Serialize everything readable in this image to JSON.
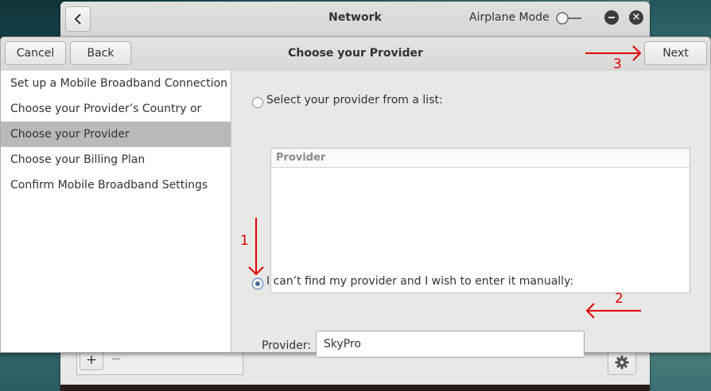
{
  "network_window": {
    "title": "Network",
    "airplane_mode_label": "Airplane Mode",
    "close_glyph": "×",
    "plus_label": "+",
    "minus_label": "−"
  },
  "dialog": {
    "cancel_label": "Cancel",
    "back_label": "Back",
    "title": "Choose your Provider",
    "next_label": "Next",
    "steps": [
      {
        "label": "Set up a Mobile Broadband Connection"
      },
      {
        "label": "Choose your Provider’s Country or Region"
      },
      {
        "label": "Choose your Provider"
      },
      {
        "label": "Choose your Billing Plan"
      },
      {
        "label": "Confirm Mobile Broadband Settings"
      }
    ],
    "selected_step": 2,
    "option_list_label": "Select your provider from a list:",
    "provider_column_header": "Provider",
    "option_manual_label": "I can’t find my provider and I wish to enter it manually:",
    "manual_selected": true,
    "provider_field_label": "Provider:",
    "provider_value": "SkyPro"
  },
  "annotations": {
    "color": "#e10000",
    "labels": [
      "1",
      "2",
      "3"
    ]
  }
}
